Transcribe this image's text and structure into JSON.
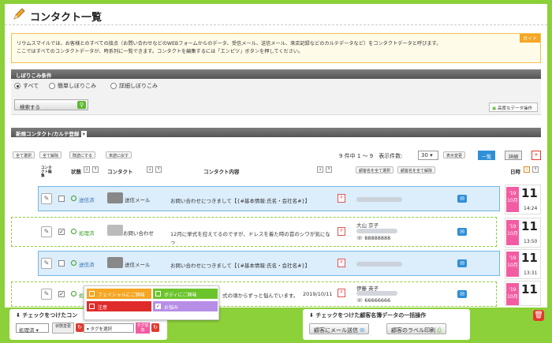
{
  "page": {
    "title": "コンタクト一覧"
  },
  "guide": {
    "tag": "ガイド",
    "line1": "リウムスマイルでは、お客様とのすべての接点（お問い合わせなどのWEBフォームからのデータ、受信メール、送信メール、来店記録などのカルテデータなど）をコンタクトデータと呼びます。",
    "line2": "ここではすべてのコンタクトデータが、時系列に一覧できます。コンタクトを編集するには「エンピツ」ボタンを押してください。"
  },
  "filter": {
    "section": "しぼりこみ条件",
    "options": [
      "すべて",
      "簡単しぼりこみ",
      "詳細しぼりこみ"
    ],
    "search_button": "検索する",
    "advanced_button": "高度なデータ操作"
  },
  "newbar": {
    "label": "新規コンタクト/カルテ登録"
  },
  "toolbar": {
    "select_all": "全て選択",
    "clear_all": "全て解除",
    "mark_read": "既読にする",
    "mark_unread": "未読に戻す",
    "count": "9 件中 1 ～ 9",
    "per_page_label": "表示件数:",
    "per_page": "30",
    "display_change": "表示変更",
    "view_list": "一覧",
    "view_detail": "詳細"
  },
  "headers": {
    "edit": "コンタクト編集",
    "status": "状態",
    "contact": "コンタクト",
    "content": "コンタクト内容",
    "select_customers": "顧客名を全て選択",
    "clear_customers": "顧客名を全て解除",
    "date": "日時"
  },
  "rows": [
    {
      "status": "送信済",
      "kind": "送信メール",
      "content": "お問い合わせにつきまして【{#基本情報:氏名・会社名#}】",
      "customer_name": "",
      "phone": "",
      "year": "'19",
      "month": "10月",
      "day": "11",
      "time": "14:24",
      "checked": false
    },
    {
      "status": "処理済",
      "kind": "お問い合わせ",
      "content": "12月に挙式を控えてるのですが、ドレスを着た時の首のシワが気になっ",
      "customer_name": "大山 京子",
      "phone": "88888888",
      "year": "'19",
      "month": "10月",
      "day": "11",
      "time": "13:50",
      "checked": true
    },
    {
      "status": "送信済",
      "kind": "送信メール",
      "content": "お問い合わせにつきまして【{#基本情報:氏名・会社名#}】",
      "customer_name": "",
      "phone": "",
      "year": "'19",
      "month": "10月",
      "day": "11",
      "time": "13:31",
      "checked": false
    },
    {
      "status": "処",
      "kind": "",
      "content": "式の頃からずっと悩んでいます。",
      "date_text": "2019/10/11",
      "customer_name": "伊藤 英子",
      "phone": "66666666",
      "year": "'19",
      "month": "10月",
      "day": "11",
      "time": "",
      "checked": true
    }
  ],
  "tag_popup": {
    "items": [
      {
        "label": "フェイシャルにご興味",
        "color": "#f5a623",
        "checked": false
      },
      {
        "label": "ボディにご興味",
        "color": "#6cc42d",
        "checked": false
      },
      {
        "label": "注意",
        "color": "#e02b2b",
        "checked": false
      },
      {
        "label": "お悩み",
        "color": "#b78ee6",
        "checked": true
      }
    ],
    "select_placeholder": "タグを選択",
    "tag_button": "タグ追加"
  },
  "bottom": {
    "left_title": "チェックをつけたコン",
    "status_select": "処理済",
    "status_button": "状態変更",
    "right_title": "チェックをつけた顧客名簿データの一括操作",
    "email_button": "顧客にメール送信",
    "label_button": "顧客のラベル印刷"
  },
  "colors": {
    "accent": "#8cd03a",
    "row_blue": "#dcedfb",
    "date_pink": "#f25ca2"
  }
}
